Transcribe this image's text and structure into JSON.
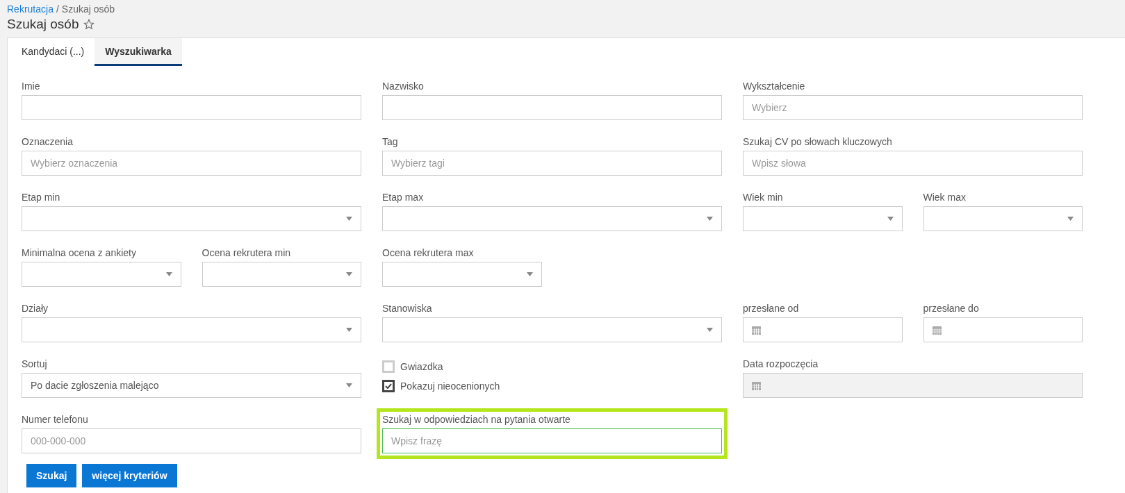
{
  "breadcrumb": {
    "link": "Rekrutacja",
    "separator": "/",
    "current": "Szukaj osób"
  },
  "title": "Szukaj osób",
  "tabs": [
    {
      "label": "Kandydaci (...)",
      "selected": false
    },
    {
      "label": "Wyszukiwarka",
      "selected": true
    }
  ],
  "rows": [
    {
      "fields": [
        {
          "kind": "text",
          "label": "Imie"
        },
        {
          "kind": "text",
          "label": "Nazwisko"
        },
        {
          "kind": "text",
          "label": "Wykształcenie",
          "placeholder": "Wybierz"
        }
      ]
    },
    {
      "fields": [
        {
          "kind": "text",
          "label": "Oznaczenia",
          "placeholder": "Wybierz oznaczenia"
        },
        {
          "kind": "text",
          "label": "Tag",
          "placeholder": "Wybierz tagi"
        },
        {
          "kind": "text",
          "label": "Szukaj CV po słowach kluczowych",
          "placeholder": "Wpisz słowa"
        }
      ]
    },
    {
      "fields": [
        {
          "kind": "select",
          "label": "Etap min"
        },
        {
          "kind": "select",
          "label": "Etap max"
        },
        {
          "kind": "short-select",
          "label": "Wiek min"
        },
        {
          "kind": "short-select",
          "label": "Wiek max"
        }
      ]
    },
    {
      "fields": [
        {
          "kind": "short-select",
          "label": "Minimalna ocena z ankiety"
        },
        {
          "kind": "short-select",
          "label": "Ocena rekrutera min"
        },
        {
          "kind": "short-select",
          "label": "Ocena rekrutera max"
        }
      ]
    },
    {
      "fields": [
        {
          "kind": "select",
          "label": "Działy"
        },
        {
          "kind": "select",
          "label": "Stanowiska"
        },
        {
          "kind": "short-date",
          "label": "przesłane od",
          "disabled": false
        },
        {
          "kind": "short-date",
          "label": "przesłane do",
          "disabled": false
        }
      ]
    },
    {
      "fields": [
        {
          "kind": "select",
          "label": "Sortuj",
          "value": "Po dacie zgłoszenia malejąco"
        },
        {
          "kind": "checkboxes",
          "options": [
            {
              "label": "Gwiazdka",
              "checked": false
            },
            {
              "label": "Pokazuj nieocenionych",
              "checked": true
            }
          ]
        },
        {
          "kind": "date",
          "label": "Data rozpoczęcia",
          "disabled": true
        }
      ]
    },
    {
      "fields": [
        {
          "kind": "text",
          "label": "Numer telefonu",
          "placeholder": "000-000-000"
        },
        {
          "kind": "text",
          "label": "Szukaj w odpowiedziach na pytania otwarte",
          "placeholder": "Wpisz frazę",
          "highlighted": true
        }
      ]
    }
  ],
  "buttons": [
    "Szukaj",
    "więcej kryteriów"
  ]
}
